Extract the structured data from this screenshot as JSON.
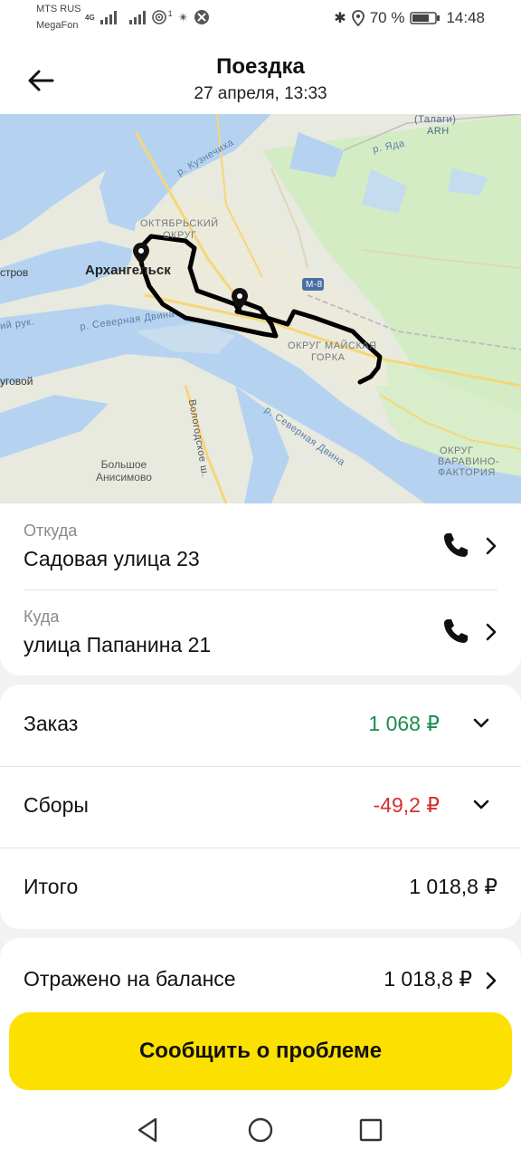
{
  "status_bar": {
    "operator1": "MTS RUS",
    "operator2": "MegaFon",
    "network": "4G",
    "hotspot_superscript": "1",
    "battery": "70 %",
    "time": "14:48"
  },
  "header": {
    "title": "Поездка",
    "subtitle": "27 апреля, 13:33"
  },
  "map": {
    "city": "Архангельск",
    "labels": {
      "oktyabrsky": "ОКТЯБРЬСКИЙ",
      "okrug": "ОКРУГ",
      "kuznechikha": "р. Кузнечиха",
      "talagi": "(Талаги)",
      "arh": "ARH",
      "yada": "р. Яда",
      "m8": "М-8",
      "mayskaya1": "ОКРУГ МАЙСКАЯ",
      "mayskaya2": "ГОРКА",
      "severnaya_dvina1": "р. Северная Двина",
      "severnaya_dvina2": "р. Северная Двина",
      "vologodskoe": "Вологодское ш.",
      "bolshoe1": "Большое",
      "bolshoe2": "Анисимово",
      "varavino1": "ОКРУГ",
      "varavino2": "ВАРАВИНО-",
      "varavino3": "ФАКТОРИЯ",
      "ostrov": "стров",
      "ugovoy": "уговой",
      "ruk": "ий рук."
    }
  },
  "addresses": {
    "from_label": "Откуда",
    "from_value": "Садовая улица 23",
    "to_label": "Куда",
    "to_value": "улица Папанина 21"
  },
  "finance": {
    "order_label": "Заказ",
    "order_amount": "1 068 ₽",
    "fees_label": "Сборы",
    "fees_amount": "-49,2 ₽",
    "total_label": "Итого",
    "total_amount": "1 018,8 ₽",
    "balance_label": "Отражено на балансе",
    "balance_amount": "1 018,8 ₽"
  },
  "action": {
    "report_label": "Сообщить о проблеме"
  },
  "colors": {
    "accent": "#fce000",
    "positive": "#1a8d4e",
    "negative": "#d0302f"
  }
}
